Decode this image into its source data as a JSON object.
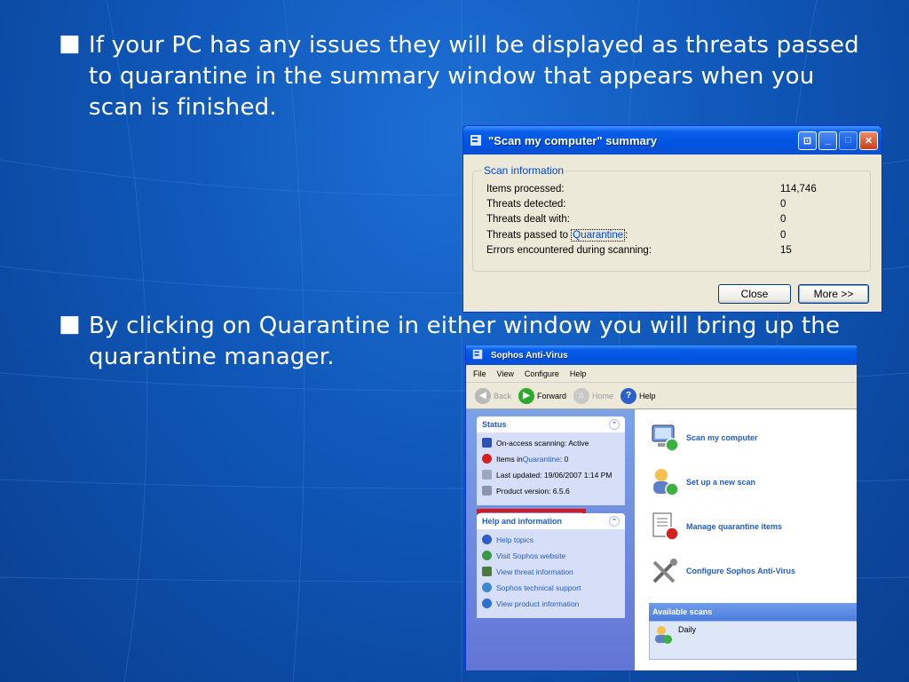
{
  "slide": {
    "bullet_1": "If your PC has any issues they will be displayed as threats passed to quarantine in the summary window that appears when you scan is finished.",
    "bullet_2": "By clicking on Quarantine in either window you will bring up the quarantine manager.",
    "bullet_marker": "■"
  },
  "summary_window": {
    "title": "\"Scan my computer\" summary",
    "group_label": "Scan information",
    "rows": [
      {
        "label": "Items processed:",
        "value": "114,746"
      },
      {
        "label": "Threats detected:",
        "value": "0"
      },
      {
        "label": "Threats dealt with:",
        "value": "0"
      },
      {
        "label_prefix": "Threats passed to ",
        "label_link": "Quarantine",
        "label_suffix": ":",
        "value": "0"
      },
      {
        "label": "Errors encountered during scanning:",
        "value": "15"
      }
    ],
    "close_button": "Close",
    "more_button": "More >>"
  },
  "sophos_window": {
    "title": "Sophos Anti-Virus",
    "menu": [
      "File",
      "View",
      "Configure",
      "Help"
    ],
    "toolbar": {
      "back": "Back",
      "forward": "Forward",
      "home": "Home",
      "help": "Help"
    },
    "status_panel": {
      "title": "Status",
      "items": [
        {
          "text": "On-access scanning: Active"
        },
        {
          "prefix": "Items in ",
          "link": "Quarantine",
          "suffix": ": 0"
        },
        {
          "text": "Last updated: 19/06/2007 1:14 PM"
        },
        {
          "text": "Product version: 6.5.6"
        }
      ]
    },
    "help_panel": {
      "title": "Help and information",
      "items": [
        "Help topics",
        "Visit Sophos website",
        "View threat information",
        "Sophos technical support",
        "View product information"
      ]
    },
    "tasks": [
      "Scan my computer",
      "Set up a new scan",
      "Manage quarantine items",
      "Configure Sophos Anti-Virus"
    ],
    "available_scans": {
      "title": "Available scans",
      "items": [
        "Daily"
      ]
    }
  },
  "colors": {
    "highlight": "#e1141a",
    "xp_title": "#0054e3",
    "link": "#215dc6"
  }
}
